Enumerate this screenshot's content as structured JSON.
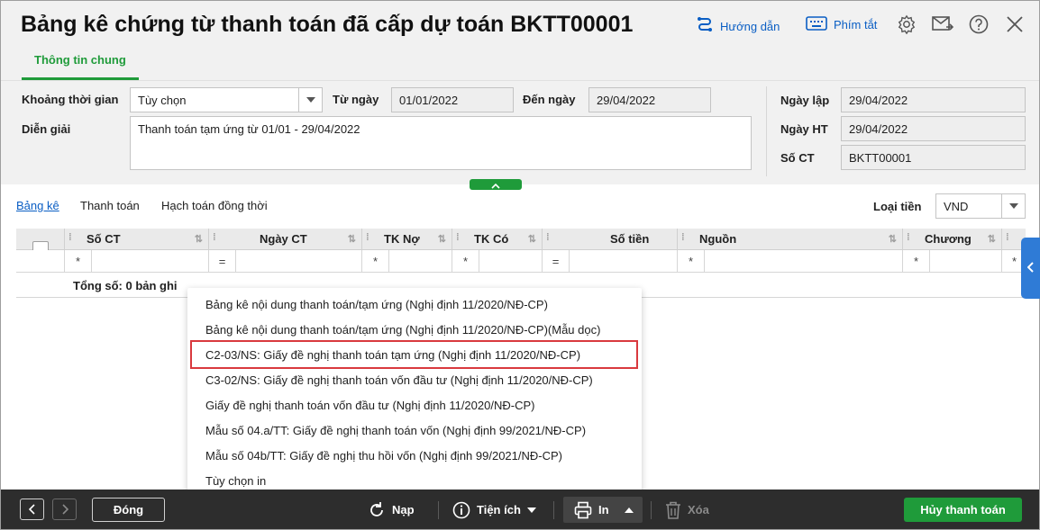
{
  "header": {
    "title": "Bảng kê chứng từ thanh toán đã cấp dự toán BKTT00001",
    "help_label": "Hướng dẫn",
    "shortcut_label": "Phím tắt",
    "tab_general": "Thông tin chung",
    "accent_color": "#1f9b3a",
    "link_color": "#0a5ec4"
  },
  "form": {
    "period_label": "Khoảng thời gian",
    "period_value": "Tùy chọn",
    "from_label": "Từ ngày",
    "from_value": "01/01/2022",
    "to_label": "Đến ngày",
    "to_value": "29/04/2022",
    "desc_label": "Diễn giải",
    "desc_value": "Thanh toán tạm ứng từ 01/01 - 29/04/2022",
    "created_label": "Ngày lập",
    "created_value": "29/04/2022",
    "accounting_label": "Ngày HT",
    "accounting_value": "29/04/2022",
    "voucher_label": "Số CT",
    "voucher_value": "BKTT00001"
  },
  "subtabs": {
    "list": "Bảng kê",
    "payment": "Thanh toán",
    "simultaneous": "Hạch toán đồng thời"
  },
  "currency": {
    "label": "Loại tiền",
    "value": "VND"
  },
  "grid": {
    "columns": [
      "Số CT",
      "Ngày CT",
      "TK Nợ",
      "TK Có",
      "Số tiền",
      "Nguồn",
      "Chương"
    ],
    "filter_ops": [
      "*",
      "=",
      "*",
      "*",
      "=",
      "*",
      "*",
      "*"
    ],
    "total_label": "Tổng số: 0 bản ghi"
  },
  "print_menu": {
    "items": [
      "Bảng kê nội dung thanh toán/tạm ứng (Nghị định 11/2020/NĐ-CP)",
      "Bảng kê nội dung thanh toán/tạm ứng (Nghị định 11/2020/NĐ-CP)(Mẫu dọc)",
      "C2-03/NS: Giấy đề nghị thanh toán tạm ứng (Nghị định 11/2020/NĐ-CP)",
      "C3-02/NS: Giấy đề nghị thanh toán vốn đầu tư (Nghị định 11/2020/NĐ-CP)",
      "Giấy đề nghị thanh toán vốn đầu tư (Nghị định 11/2020/NĐ-CP)",
      "Mẫu số 04.a/TT: Giấy đề nghị thanh toán vốn (Nghị định 99/2021/NĐ-CP)",
      "Mẫu số 04b/TT: Giấy đề nghị thu hồi vốn (Nghị định 99/2021/NĐ-CP)",
      "Tùy chọn in"
    ],
    "highlighted_index": 2,
    "highlight_color": "#d9393e"
  },
  "footer": {
    "close_label": "Đóng",
    "reload_label": "Nạp",
    "utility_label": "Tiện ích",
    "print_label": "In",
    "delete_label": "Xóa",
    "cancel_payment_label": "Hủy thanh toán"
  }
}
